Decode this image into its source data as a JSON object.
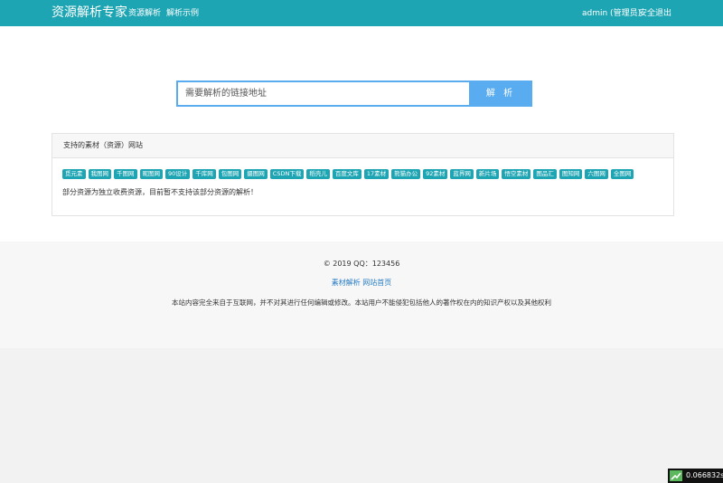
{
  "header": {
    "brand": "资源解析专家",
    "nav": [
      "资源解析",
      "解析示例"
    ],
    "user": "admin (管理员)",
    "logout": "安全退出"
  },
  "search": {
    "placeholder": "需要解析的链接地址",
    "button": "解 析"
  },
  "panel": {
    "title": "支持的素材（资源）网站",
    "sites": [
      "觅元素",
      "我图网",
      "千图网",
      "昵图网",
      "90设计",
      "千库网",
      "包图网",
      "摄图网",
      "CSDN下载",
      "稻壳儿",
      "百度文库",
      "17素材",
      "熊猫办公",
      "92素材",
      "蓝界网",
      "新片场",
      "悟空素材",
      "图品汇",
      "图知网",
      "六图网",
      "全图网"
    ],
    "note": "部分资源为独立收费资源，目前暂不支持该部分资源的解析！"
  },
  "footer": {
    "copyright": "© 2019 QQ：123456",
    "links": [
      "素材解析",
      "网站首页"
    ],
    "disclaimer": "本站内容完全来自于互联网，并不对其进行任何编辑或修改。本站用户不能侵犯包括他人的著作权在内的知识产权以及其他权利"
  },
  "timer": {
    "value": "0.066832s",
    "icon": "chart-icon",
    "icon_color": "#5cb85c"
  },
  "colors": {
    "topbar": "#1ea5b3",
    "button": "#5aacf0",
    "tag": "#1ea5b3",
    "link": "#2a7ec5"
  }
}
